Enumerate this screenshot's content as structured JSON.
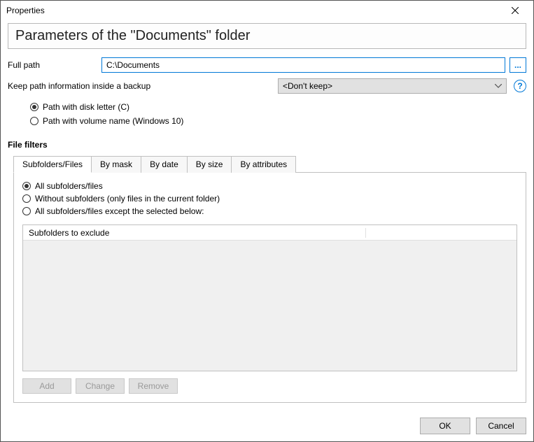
{
  "window": {
    "title": "Properties"
  },
  "header": {
    "title": "Parameters of the \"Documents\" folder"
  },
  "fullpath": {
    "label": "Full path",
    "value": "C:\\Documents",
    "browse": "..."
  },
  "keep_path": {
    "label": "Keep path information inside a backup",
    "combo_value": "<Don't keep>",
    "options": [
      {
        "label": "Path with disk letter (C)",
        "selected": true
      },
      {
        "label": "Path with volume name (Windows 10)",
        "selected": false
      }
    ]
  },
  "filters": {
    "section_label": "File filters",
    "tabs": [
      {
        "label": "Subfolders/Files",
        "active": true
      },
      {
        "label": "By mask"
      },
      {
        "label": "By date"
      },
      {
        "label": "By size"
      },
      {
        "label": "By attributes"
      }
    ],
    "scope": [
      {
        "label": "All subfolders/files",
        "selected": true
      },
      {
        "label": "Without subfolders (only files in the current folder)",
        "selected": false
      },
      {
        "label": "All subfolders/files except the selected below:",
        "selected": false
      }
    ],
    "exclude_header": "Subfolders to exclude",
    "buttons": {
      "add": "Add",
      "change": "Change",
      "remove": "Remove"
    }
  },
  "footer": {
    "ok": "OK",
    "cancel": "Cancel"
  },
  "help": "?"
}
